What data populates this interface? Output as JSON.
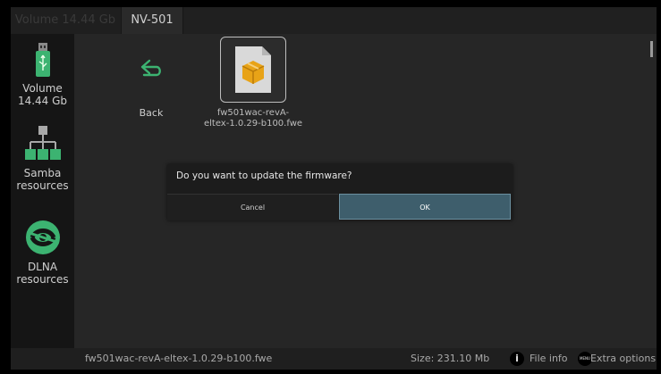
{
  "tabs": [
    {
      "label": "Volume 14.44 Gb",
      "state": "inactive"
    },
    {
      "label": "NV-501",
      "state": "active"
    }
  ],
  "sidebar": {
    "items": [
      {
        "label_line1": "Volume",
        "label_line2": "14.44 Gb",
        "icon": "usb-drive-icon"
      },
      {
        "label_line1": "Samba",
        "label_line2": "resources",
        "icon": "network-tree-icon"
      },
      {
        "label_line1": "DLNA",
        "label_line2": "resources",
        "icon": "dlna-icon"
      }
    ]
  },
  "files": {
    "back_label": "Back",
    "file_name_line1": "fw501wac-revA-",
    "file_name_line2": "eltex-1.0.29-b100.fwe"
  },
  "dialog": {
    "message": "Do you want to update the firmware?",
    "cancel_label": "Cancel",
    "ok_label": "OK"
  },
  "status_bar": {
    "filename": "fw501wac-revA-eltex-1.0.29-b100.fwe",
    "size": "Size: 231.10 Mb",
    "info_badge": "i",
    "file_info_label": "File info",
    "menu_badge": "MENU",
    "extra_options_label": "Extra options"
  },
  "colors": {
    "accent_green": "#3cb371",
    "ok_button": "#3e5e6c",
    "folder_orange": "#e8a317"
  }
}
